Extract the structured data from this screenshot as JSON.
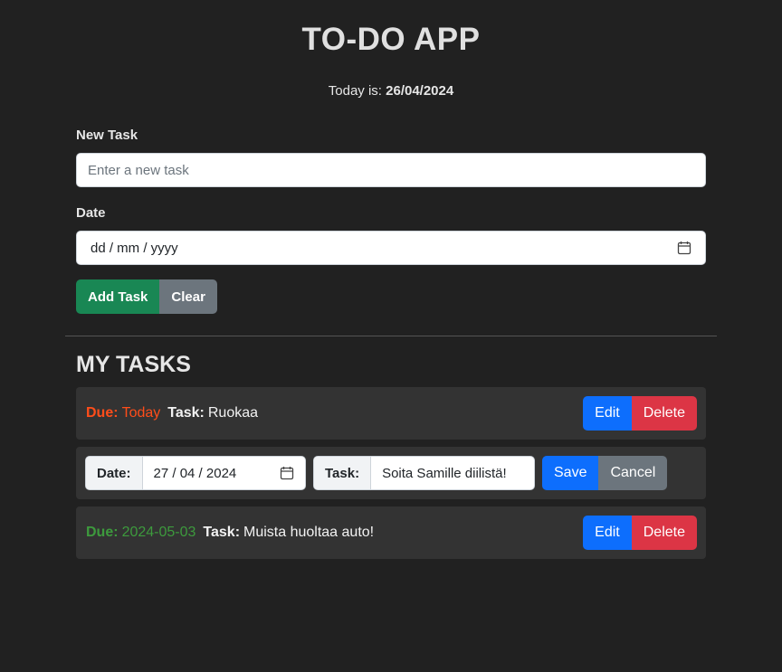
{
  "header": {
    "title": "TO-DO APP",
    "today_prefix": "Today is:",
    "today_date": "26/04/2024"
  },
  "form": {
    "task_label": "New Task",
    "task_placeholder": "Enter a new task",
    "task_value": "",
    "date_label": "Date",
    "date_value": "dd / mm / yyyy",
    "add_button": "Add Task",
    "clear_button": "Clear"
  },
  "tasks_section": {
    "title": "MY TASKS",
    "tasks": [
      {
        "due_label": "Due:",
        "due_value": "Today",
        "due_color": "#ff4d1a",
        "task_label": "Task:",
        "task_text": "Ruokaa",
        "edit_label": "Edit",
        "delete_label": "Delete"
      },
      {
        "editing": true,
        "date_label": "Date:",
        "date_value": "27 / 04 / 2024",
        "task_label": "Task:",
        "task_value": "Soita Samille diilistä!",
        "save_label": "Save",
        "cancel_label": "Cancel"
      },
      {
        "due_label": "Due:",
        "due_value": "2024-05-03",
        "due_color": "#3d9a3d",
        "task_label": "Task:",
        "task_text": "Muista huoltaa auto!",
        "edit_label": "Edit",
        "delete_label": "Delete"
      }
    ]
  },
  "colors": {
    "background": "#212121",
    "success": "#198754",
    "secondary": "#6c757d",
    "primary": "#0d6efd",
    "danger": "#dc3545"
  },
  "icons": {
    "calendar": "calendar-icon"
  }
}
